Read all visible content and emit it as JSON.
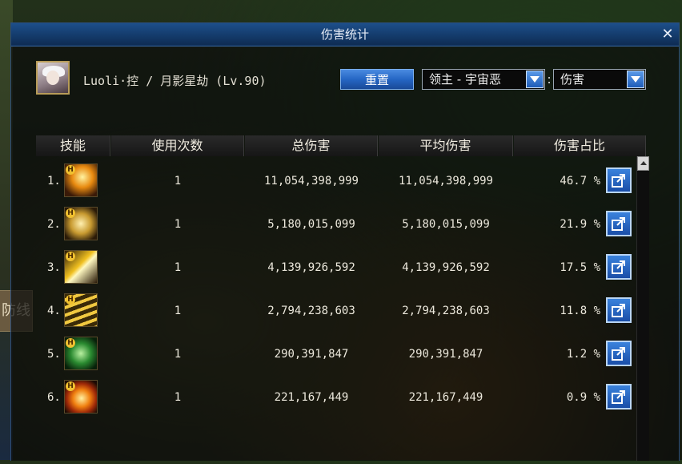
{
  "window": {
    "title": "伤害统计"
  },
  "player": {
    "label": "Luoli·控 / 月影星劫 (Lv.90)"
  },
  "controls": {
    "reset_label": "重置",
    "boss_select_value": "领主 - 宇宙恶",
    "colon": ":",
    "type_select_value": "伤害"
  },
  "table": {
    "headers": [
      "技能",
      "使用次数",
      "总伤害",
      "平均伤害",
      "伤害占比"
    ],
    "rows": [
      {
        "rank": "1.",
        "skill_icon": "starburst-slash-icon",
        "uses": "1",
        "total": "11,054,398,999",
        "avg": "11,054,398,999",
        "pct": "46.7 %"
      },
      {
        "rank": "2.",
        "skill_icon": "sparkle-burst-icon",
        "uses": "1",
        "total": "5,180,015,099",
        "avg": "5,180,015,099",
        "pct": "21.9 %"
      },
      {
        "rank": "3.",
        "skill_icon": "lightning-bolt-icon",
        "uses": "1",
        "total": "4,139,926,592",
        "avg": "4,139,926,592",
        "pct": "17.5 %"
      },
      {
        "rank": "4.",
        "skill_icon": "whirlwind-icon",
        "uses": "1",
        "total": "2,794,238,603",
        "avg": "2,794,238,603",
        "pct": "11.8 %"
      },
      {
        "rank": "5.",
        "skill_icon": "green-shard-icon",
        "uses": "1",
        "total": "290,391,847",
        "avg": "290,391,847",
        "pct": "1.2 %"
      },
      {
        "rank": "6.",
        "skill_icon": "fire-orb-icon",
        "uses": "1",
        "total": "221,167,449",
        "avg": "221,167,449",
        "pct": "0.9 %"
      }
    ]
  },
  "background": {
    "sign_text": "防线"
  },
  "colors": {
    "titlebar": "#143b6b",
    "button_blue": "#2566c4",
    "text": "#ece8dc"
  }
}
